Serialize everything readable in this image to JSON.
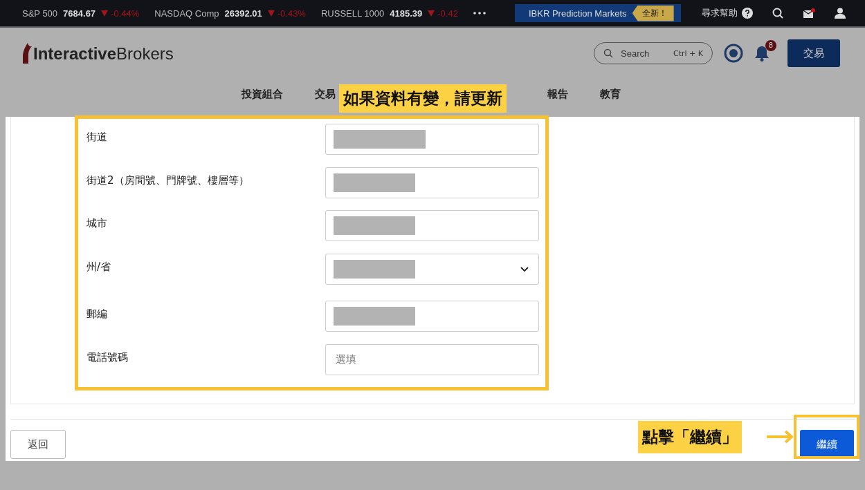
{
  "ticker": [
    {
      "name": "S&P 500",
      "value": "7684.67",
      "falling": true,
      "change": "-0.44%"
    },
    {
      "name": "NASDAQ Comp",
      "value": "26392.01",
      "falling": true,
      "change": "-0.43%"
    },
    {
      "name": "RUSSELL 1000",
      "value": "4185.39",
      "falling": true,
      "change": "-0.42"
    }
  ],
  "promo": {
    "label": "IBKR Prediction Markets",
    "badge": "全新！"
  },
  "help": {
    "label": "尋求幫助"
  },
  "mail": {
    "unread": true
  },
  "header": {
    "logo_bold": "Interactive",
    "logo_light": "Brokers",
    "search": {
      "placeholder": "Search",
      "shortcut": "Ctrl + K"
    },
    "notifications": "8",
    "trade_button": "交易"
  },
  "nav": [
    {
      "label": "投資組合"
    },
    {
      "label": "交易"
    },
    {
      "label": "報告"
    },
    {
      "label": "教育"
    }
  ],
  "form": {
    "fields": [
      {
        "label": "街道",
        "kind": "text",
        "redacted": true
      },
      {
        "label": "街道2（房間號、門牌號、樓層等）",
        "kind": "text",
        "redacted": true
      },
      {
        "label": "城市",
        "kind": "text",
        "redacted": true
      },
      {
        "label": "州/省",
        "kind": "select",
        "redacted": true
      },
      {
        "label": "郵編",
        "kind": "text",
        "redacted": true
      },
      {
        "label": "電話號碼",
        "kind": "text",
        "redacted": false,
        "placeholder": "選填"
      }
    ]
  },
  "buttons": {
    "back": "返回",
    "continue": "繼續"
  },
  "annotations": {
    "form_note": "如果資料有變，請更新",
    "button_note": "點擊「繼續」"
  }
}
